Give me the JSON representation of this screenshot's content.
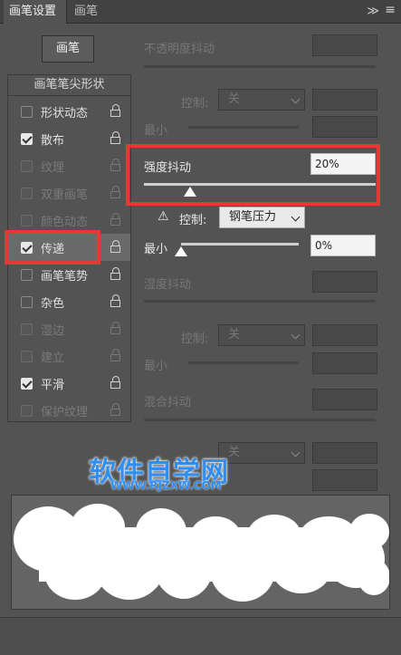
{
  "tabs": {
    "brush_settings": "画笔设置",
    "brush": "画笔"
  },
  "panel": {
    "collapse_glyph": "≫",
    "menu_glyph": "≡"
  },
  "brush_button": "画笔",
  "list": {
    "title": "画笔笔尖形状",
    "items": [
      {
        "label": "形状动态",
        "checked": false,
        "enabled": true
      },
      {
        "label": "散布",
        "checked": true,
        "enabled": true
      },
      {
        "label": "纹理",
        "checked": false,
        "enabled": false
      },
      {
        "label": "双重画笔",
        "checked": false,
        "enabled": false
      },
      {
        "label": "颜色动态",
        "checked": false,
        "enabled": false
      },
      {
        "label": "传递",
        "checked": true,
        "enabled": true,
        "selected": true
      },
      {
        "label": "画笔笔势",
        "checked": false,
        "enabled": true
      },
      {
        "label": "杂色",
        "checked": false,
        "enabled": true
      },
      {
        "label": "湿边",
        "checked": false,
        "enabled": false
      },
      {
        "label": "建立",
        "checked": false,
        "enabled": false
      },
      {
        "label": "平滑",
        "checked": true,
        "enabled": true
      },
      {
        "label": "保护纹理",
        "checked": false,
        "enabled": false
      }
    ]
  },
  "settings": {
    "opacity_jitter": "不透明度抖动",
    "control_label": "控制:",
    "control_off": "关",
    "minimum": "最小",
    "flow_jitter": "强度抖动",
    "flow_jitter_value": "20%",
    "flow_jitter_level": 0.2,
    "flow_control": "钢笔压力",
    "flow_minimum_value": "0%",
    "flow_minimum_level": 0,
    "wetness_jitter": "湿度抖动",
    "mix_jitter": "混合抖动",
    "warning_glyph": "⚠"
  },
  "watermark": {
    "title": "软件自学网",
    "url": "WWW.RJZXW.COM"
  },
  "colors": {
    "highlight": "#e53935",
    "accent": "#2f8ef0"
  }
}
